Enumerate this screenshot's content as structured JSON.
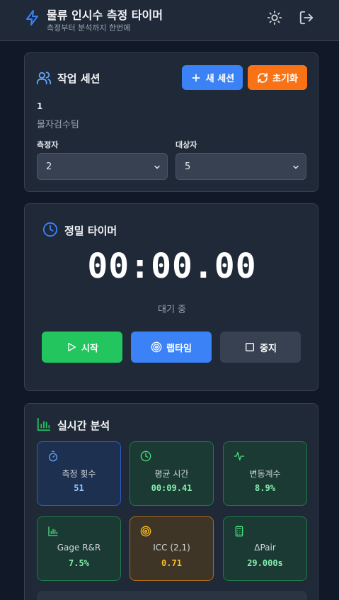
{
  "header": {
    "title": "물류 인시수 측정 타이머",
    "subtitle": "측정부터 분석까지 한번에",
    "icons": [
      "bolt-icon",
      "sun-icon",
      "logout-icon"
    ]
  },
  "session": {
    "title": "작업 세션",
    "new_label": "새 세션",
    "reset_label": "초기화",
    "number": "1",
    "team": "물자검수팀",
    "measurer_label": "측정자",
    "measurer_value": "2",
    "subject_label": "대상자",
    "subject_value": "5"
  },
  "timer": {
    "title": "정밀 타이머",
    "display": "00:00.00",
    "status": "대기 중",
    "start_label": "시작",
    "lap_label": "랩타임",
    "stop_label": "중지"
  },
  "analysis": {
    "title": "실시간 분석",
    "stats": [
      {
        "label": "측정 횟수",
        "value": "51",
        "icon": "stopwatch-icon"
      },
      {
        "label": "평균 시간",
        "value": "00:09.41",
        "icon": "clock-icon"
      },
      {
        "label": "변동계수",
        "value": "8.9%",
        "icon": "activity-icon"
      },
      {
        "label": "Gage R&R",
        "value": "7.5%",
        "icon": "bar-chart-icon"
      },
      {
        "label": "ICC (2,1)",
        "value": "0.71",
        "icon": "target-icon"
      },
      {
        "label": "ΔPair",
        "value": "29.000s",
        "icon": "calculator-icon"
      }
    ]
  },
  "colors": {
    "background": "#111827",
    "card": "#1f2937",
    "primary": "#3b82f6",
    "orange": "#f97316",
    "green": "#22c55e"
  }
}
